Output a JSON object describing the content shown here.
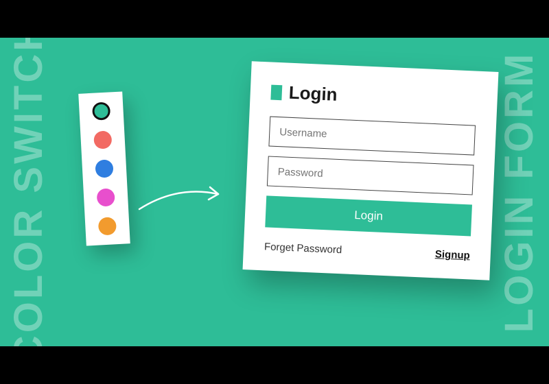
{
  "background_texts": {
    "left": "COLOR SWITCH",
    "right": "LOGIN FORM"
  },
  "palette": {
    "swatches": [
      {
        "color": "#2ebd97",
        "selected": true
      },
      {
        "color": "#f26a63",
        "selected": false
      },
      {
        "color": "#2f7ee0",
        "selected": false
      },
      {
        "color": "#e84fcd",
        "selected": false
      },
      {
        "color": "#f29b2e",
        "selected": false
      }
    ]
  },
  "form": {
    "title": "Login",
    "accent_color": "#2ebd97",
    "username_placeholder": "Username",
    "password_placeholder": "Password",
    "submit_label": "Login",
    "forget_label": "Forget Password",
    "signup_label": "Signup"
  }
}
